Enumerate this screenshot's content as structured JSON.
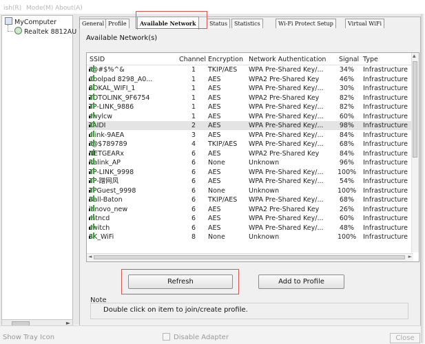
{
  "menu": {
    "items": [
      "ish(R)",
      "Mode(M)",
      "About(A)"
    ]
  },
  "tree": {
    "root": "MyComputer",
    "child": "Realtek 8812AU"
  },
  "tabs": [
    "General",
    "Profile",
    "Available Network",
    "Status",
    "Statistics",
    "Wi-Fi Protect Setup",
    "Virtual WiFi"
  ],
  "panel": {
    "label": "Available Network(s)"
  },
  "table": {
    "columns": [
      "SSID",
      "Channel",
      "Encryption",
      "Network Authentication",
      "Signal",
      "Type"
    ],
    "rows": [
      {
        "ssid": "!@#$%^&",
        "channel": "1",
        "enc": "TKIP/AES",
        "auth": "WPA Pre-Shared Key/...",
        "signal": "34%",
        "type": "Infrastructure"
      },
      {
        "ssid": "Coolpad 8298_A0...",
        "channel": "1",
        "enc": "AES",
        "auth": "WPA2 Pre-Shared Key",
        "signal": "46%",
        "type": "Infrastructure"
      },
      {
        "ssid": "SOKAL_WIFI_1",
        "channel": "1",
        "enc": "AES",
        "auth": "WPA Pre-Shared Key/...",
        "signal": "30%",
        "type": "Infrastructure"
      },
      {
        "ssid": "TOTOLINK_9F6754",
        "channel": "1",
        "enc": "AES",
        "auth": "WPA2 Pre-Shared Key",
        "signal": "82%",
        "type": "Infrastructure"
      },
      {
        "ssid": "TP-LINK_9886",
        "channel": "1",
        "enc": "AES",
        "auth": "WPA Pre-Shared Key/...",
        "signal": "82%",
        "type": "Infrastructure"
      },
      {
        "ssid": "zwylcw",
        "channel": "1",
        "enc": "AES",
        "auth": "WPA Pre-Shared Key/...",
        "signal": "60%",
        "type": "Infrastructure"
      },
      {
        "ssid": "TAIDI",
        "channel": "2",
        "enc": "AES",
        "auth": "WPA Pre-Shared Key/...",
        "signal": "98%",
        "type": "Infrastructure"
      },
      {
        "ssid": "dlink-9AEA",
        "channel": "3",
        "enc": "AES",
        "auth": "WPA Pre-Shared Key/...",
        "signal": "84%",
        "type": "Infrastructure"
      },
      {
        "ssid": "!@$789789",
        "channel": "4",
        "enc": "TKIP/AES",
        "auth": "WPA Pre-Shared Key/...",
        "signal": "68%",
        "type": "Infrastructure"
      },
      {
        "ssid": "NETGEARx",
        "channel": "6",
        "enc": "AES",
        "auth": "WPA2 Pre-Shared Key",
        "signal": "84%",
        "type": "Infrastructure"
      },
      {
        "ssid": "Ralink_AP",
        "channel": "6",
        "enc": "None",
        "auth": "Unknown",
        "signal": "96%",
        "type": "Infrastructure"
      },
      {
        "ssid": "TP-LINK_9998",
        "channel": "6",
        "enc": "AES",
        "auth": "WPA Pre-Shared Key/...",
        "signal": "100%",
        "type": "Infrastructure"
      },
      {
        "ssid": "TP-蹭网风",
        "channel": "6",
        "enc": "AES",
        "auth": "WPA Pre-Shared Key/...",
        "signal": "54%",
        "type": "Infrastructure"
      },
      {
        "ssid": "TPGuest_9998",
        "channel": "6",
        "enc": "None",
        "auth": "Unknown",
        "signal": "100%",
        "type": "Infrastructure"
      },
      {
        "ssid": "Ball-Baton",
        "channel": "6",
        "enc": "TKIP/AES",
        "auth": "WPA Pre-Shared Key/...",
        "signal": "68%",
        "type": "Infrastructure"
      },
      {
        "ssid": "lenovo_new",
        "channel": "6",
        "enc": "AES",
        "auth": "WPA2 Pre-Shared Key",
        "signal": "26%",
        "type": "Infrastructure"
      },
      {
        "ssid": "mtncd",
        "channel": "6",
        "enc": "AES",
        "auth": "WPA Pre-Shared Key/...",
        "signal": "60%",
        "type": "Infrastructure"
      },
      {
        "ssid": "switch",
        "channel": "6",
        "enc": "AES",
        "auth": "WPA Pre-Shared Key/...",
        "signal": "48%",
        "type": "Infrastructure"
      },
      {
        "ssid": "SK_WiFi",
        "channel": "8",
        "enc": "None",
        "auth": "Unknown",
        "signal": "100%",
        "type": "Infrastructure"
      }
    ]
  },
  "buttons": {
    "refresh": "Refresh",
    "add_to_profile": "Add to Profile"
  },
  "note": {
    "label": "Note",
    "text": "Double click on item to join/create profile."
  },
  "status": {
    "show_tray": "Show Tray Icon",
    "disable_adapter": "Disable Adapter",
    "close": "Close"
  },
  "colors": {
    "highlight": "#d9534f",
    "selected_row": "#e4e4e4"
  }
}
